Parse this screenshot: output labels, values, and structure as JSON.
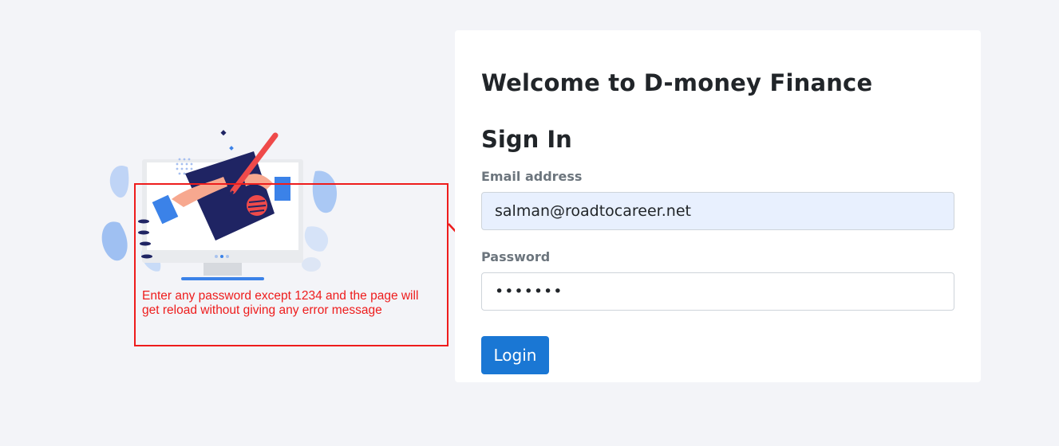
{
  "annotation": {
    "line1": "Enter any password except 1234 and the page will",
    "line2": "get reload without giving any error message"
  },
  "card": {
    "welcome_title": "Welcome to D-money Finance",
    "signin_title": "Sign In",
    "email_label": "Email address",
    "email_value": "salman@roadtocareer.net",
    "password_label": "Password",
    "password_masked": "•••••••",
    "login_label": "Login"
  },
  "colors": {
    "background": "#f3f4f8",
    "accent": "#1a77d4",
    "annotation_red": "#ee1c1c",
    "illustration_navy": "#1f2463",
    "illustration_blue": "#3b82e8"
  },
  "icons": [
    "computer-illustration",
    "pen-icon",
    "arrow-annotation"
  ]
}
